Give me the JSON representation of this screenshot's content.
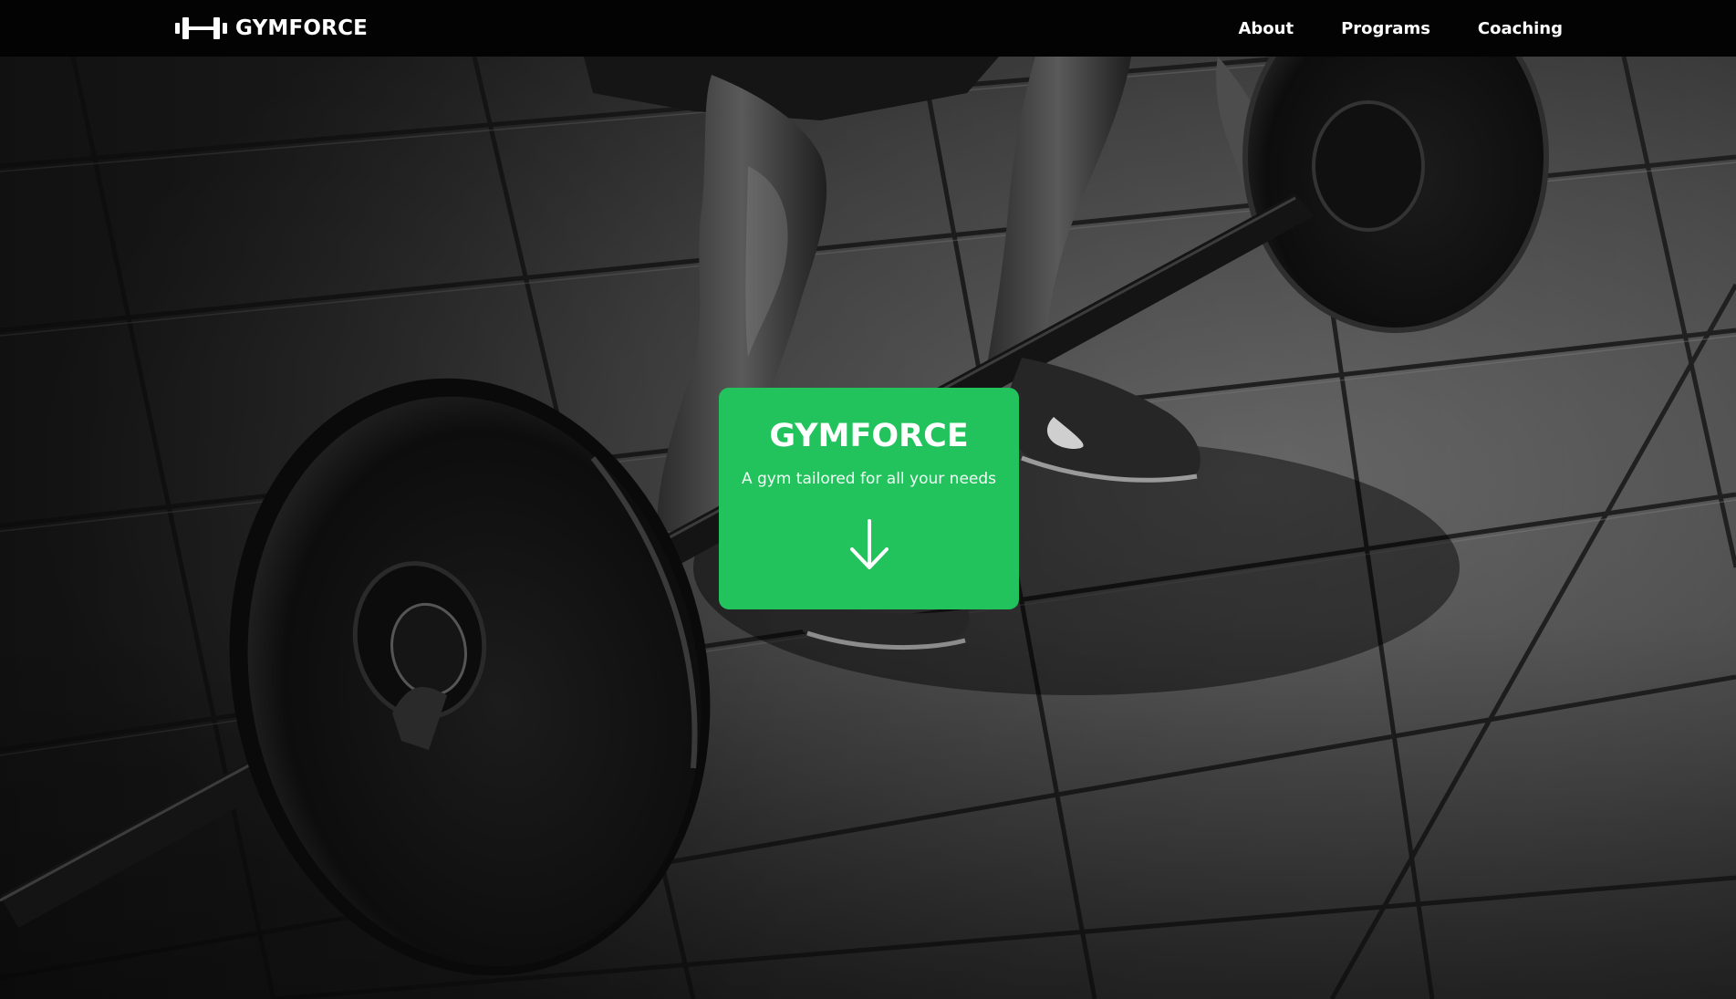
{
  "nav": {
    "brand": "GYMFORCE",
    "brand_icon": "dumbbell-icon",
    "links": [
      {
        "label": "About"
      },
      {
        "label": "Programs"
      },
      {
        "label": "Coaching"
      }
    ]
  },
  "hero": {
    "image": "black-and-white photo of a person gripping a loaded barbell on rubber gym floor tiles",
    "card": {
      "title": "GYMFORCE",
      "subtitle": "A gym tailored for all your needs",
      "scroll_icon": "arrow-down-icon"
    }
  },
  "colors": {
    "nav_background": "#030303",
    "card_background": "#22c35d",
    "text": "#ffffff"
  }
}
